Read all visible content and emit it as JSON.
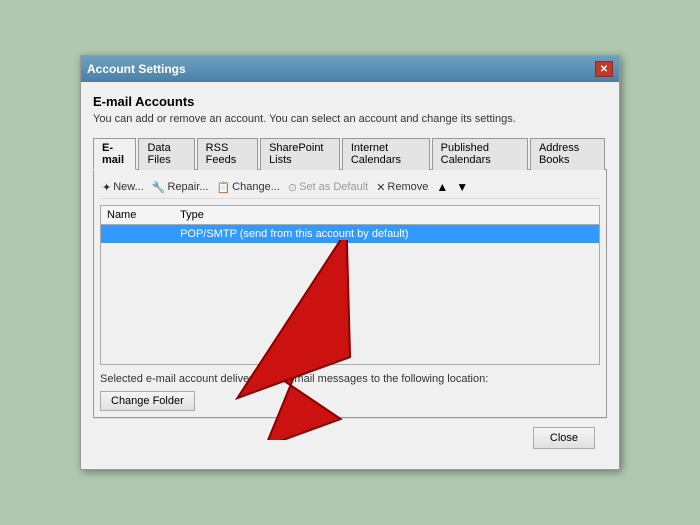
{
  "window": {
    "title": "Account Settings",
    "close_label": "✕"
  },
  "email_accounts": {
    "section_title": "E-mail Accounts",
    "section_desc": "You can add or remove an account. You can select an account and change its settings."
  },
  "tabs": [
    {
      "id": "email",
      "label": "E-mail",
      "active": true
    },
    {
      "id": "data-files",
      "label": "Data Files",
      "active": false
    },
    {
      "id": "rss-feeds",
      "label": "RSS Feeds",
      "active": false
    },
    {
      "id": "sharepoint",
      "label": "SharePoint Lists",
      "active": false
    },
    {
      "id": "internet-cal",
      "label": "Internet Calendars",
      "active": false
    },
    {
      "id": "published-cal",
      "label": "Published Calendars",
      "active": false
    },
    {
      "id": "address-books",
      "label": "Address Books",
      "active": false
    }
  ],
  "toolbar": {
    "new_label": "New...",
    "repair_label": "Repair...",
    "change_label": "Change...",
    "set_default_label": "Set as Default",
    "remove_label": "Remove"
  },
  "table": {
    "col_name": "Name",
    "col_type": "Type",
    "rows": [
      {
        "name": "",
        "type": "POP/SMTP (send from this account by default)",
        "selected": true
      }
    ]
  },
  "footer_text": "Selected e-mail account delivers new e-mail messages to the following location:",
  "change_folder_label": "Change Folder",
  "close_label": "Close"
}
